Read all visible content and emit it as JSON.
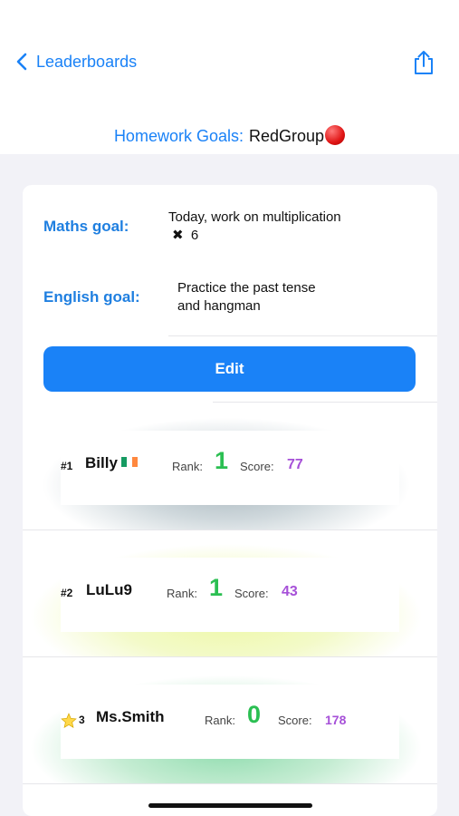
{
  "nav": {
    "back_label": "Leaderboards"
  },
  "header": {
    "label": "Homework Goals:",
    "group": "RedGroup"
  },
  "goals": {
    "maths_label": "Maths goal:",
    "maths_text_line1": "Today, work on multiplication",
    "maths_symbol": "✖",
    "maths_number": "6",
    "english_label": "English goal:",
    "english_text_line1": "Practice the past tense",
    "english_text_line2": "and hangman"
  },
  "edit_label": "Edit",
  "leaderboard": {
    "rank_label": "Rank:",
    "score_label": "Score:",
    "rows": [
      {
        "position": "#1",
        "name": "Billy",
        "rank": "1",
        "score": "77"
      },
      {
        "position": "#2",
        "name": "LuLu9",
        "rank": "1",
        "score": "43"
      },
      {
        "position": "3",
        "name": "Ms.Smith",
        "rank": "0",
        "score": "178"
      }
    ]
  },
  "colors": {
    "accent": "#1a82f7",
    "rank_green": "#2bbf52",
    "score_purple": "#a650d8"
  }
}
